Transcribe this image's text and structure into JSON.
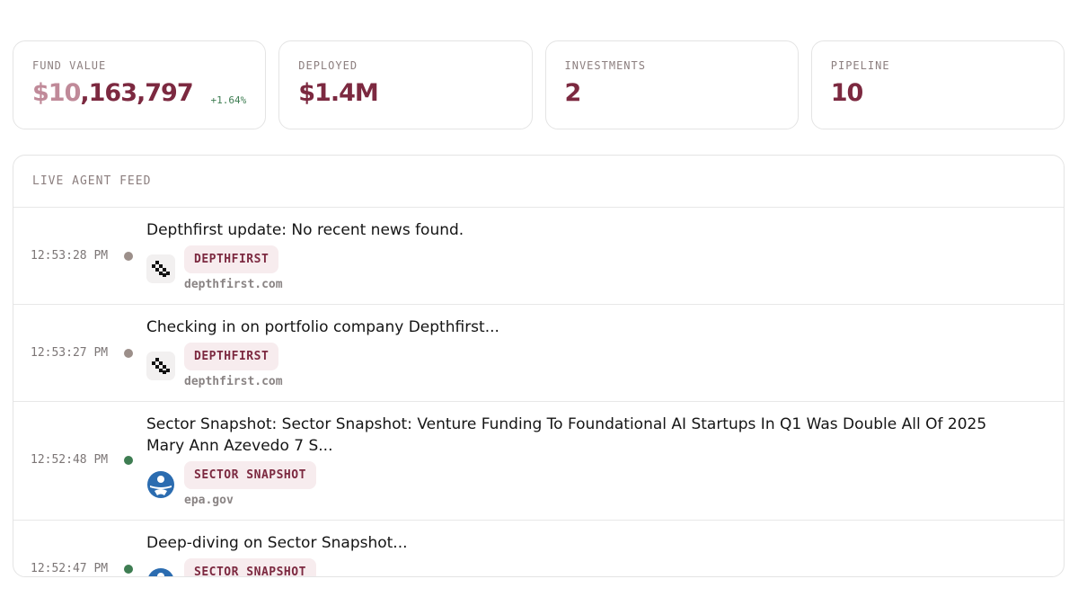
{
  "stats": [
    {
      "label": "FUND VALUE",
      "value_faded": "$10",
      "value": ",163,797",
      "delta": "+1.64%"
    },
    {
      "label": "DEPLOYED",
      "value": "$1.4M"
    },
    {
      "label": "INVESTMENTS",
      "value": "2"
    },
    {
      "label": "PIPELINE",
      "value": "10"
    }
  ],
  "colors": {
    "accent": "#7c2940",
    "positive": "#3e7d52",
    "neutral_dot": "#9c8f8a"
  },
  "feed": {
    "title": "LIVE AGENT FEED",
    "items": [
      {
        "time": "12:53:28 PM",
        "status": "grey",
        "message": "Depthfirst update: No recent news found.",
        "tag": "DEPTHFIRST",
        "domain": "depthfirst.com",
        "icon": "depthfirst-logo-icon"
      },
      {
        "time": "12:53:27 PM",
        "status": "grey",
        "message": "Checking in on portfolio company Depthfirst...",
        "tag": "DEPTHFIRST",
        "domain": "depthfirst.com",
        "icon": "depthfirst-logo-icon"
      },
      {
        "time": "12:52:48 PM",
        "status": "green",
        "message": "Sector Snapshot: Sector Snapshot: Venture Funding To Foundational AI Startups In Q1 Was Double All Of 2025 Mary Ann Azevedo 7 S...",
        "tag": "SECTOR SNAPSHOT",
        "domain": "epa.gov",
        "icon": "epa-logo-icon"
      },
      {
        "time": "12:52:47 PM",
        "status": "green",
        "message": "Deep-diving on Sector Snapshot...",
        "tag": "SECTOR SNAPSHOT",
        "domain": "",
        "icon": "epa-logo-icon"
      }
    ]
  }
}
